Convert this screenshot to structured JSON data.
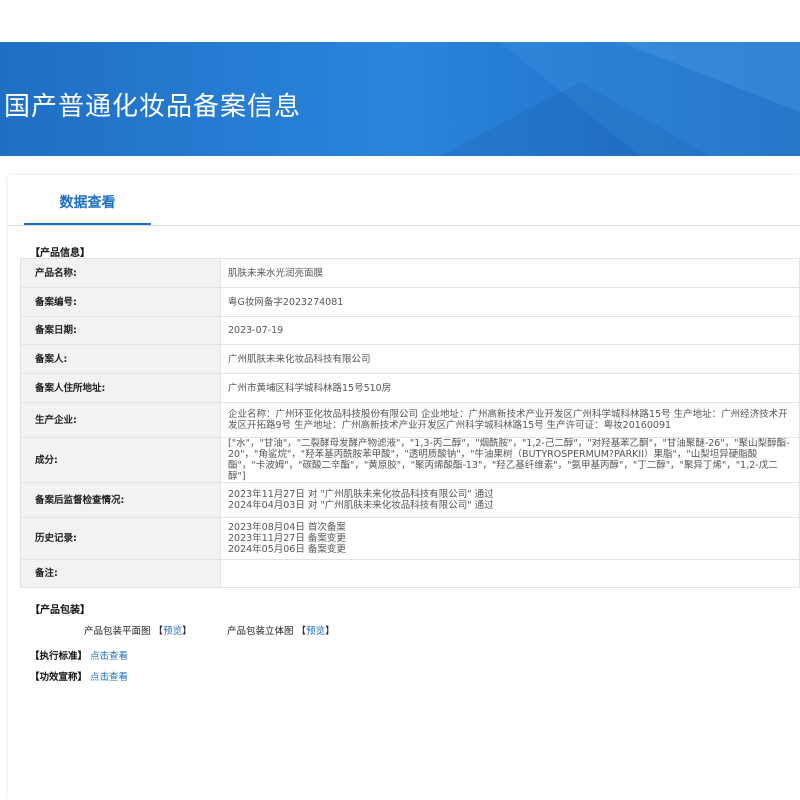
{
  "header": {
    "title": "国产普通化妆品备案信息"
  },
  "tabs": [
    {
      "label": "数据查看"
    }
  ],
  "product_info": {
    "section_title": "【产品信息】",
    "rows": [
      {
        "label": "产品名称:",
        "value": "肌肤未来水光润亮面膜"
      },
      {
        "label": "备案编号:",
        "value": "粤G妆网备字2023274081"
      },
      {
        "label": "备案日期:",
        "value": "2023-07-19"
      },
      {
        "label": "备案人:",
        "value": "广州肌肤未来化妆品科技有限公司"
      },
      {
        "label": "备案人住所地址:",
        "value": "广州市黄埔区科学城科林路15号510房"
      },
      {
        "label": "生产企业:",
        "value": "企业名称：广州环亚化妆品科技股份有限公司 企业地址：广州高新技术产业开发区广州科学城科林路15号 生产地址：广州经济技术开发区开拓路9号 生产地址：广州高新技术产业开发区广州科学城科林路15号 生产许可证：粤妆20160091"
      },
      {
        "label": "成分:",
        "value": "[\"水\"，\"甘油\"，\"二裂酵母发酵产物滤液\"，\"1,3-丙二醇\"，\"烟酰胺\"，\"1,2-己二醇\"，\"对羟基苯乙酮\"，\"甘油聚醚-26\"，\"聚山梨醇酯-20\"，\"角鲨烷\"，\"羟苯基丙酰胺苯甲酸\"，\"透明质酸钠\"，\"牛油果树（BUTYROSPERMUM?PARKII）果脂\"，\"山梨坦异硬脂酸酯\"，\"卡波姆\"，\"碳酸二辛酯\"，\"黄原胶\"，\"聚丙烯酸酯-13\"，\"羟乙基纤维素\"，\"氨甲基丙醇\"，\"丁二醇\"，\"聚异丁烯\"，\"1,2-戊二醇\"]"
      },
      {
        "label": "备案后监督检查情况:",
        "value": "2023年11月27日 对 \"广州肌肤未来化妆品科技有限公司\" 通过\n2024年04月03日 对 \"广州肌肤未来化妆品科技有限公司\" 通过"
      },
      {
        "label": "历史记录:",
        "value": "2023年08月04日 首次备案\n2023年11月27日 备案变更\n2024年05月06日 备案变更"
      },
      {
        "label": "备注:",
        "value": ""
      }
    ]
  },
  "packaging": {
    "section_title": "【产品包装】",
    "flat": {
      "label": "产品包装平面图",
      "bracket_open": "【",
      "link": "预览",
      "bracket_close": "】"
    },
    "solid": {
      "label": "产品包装立体图",
      "bracket_open": "【",
      "link": "预览",
      "bracket_close": "】"
    }
  },
  "standard": {
    "label": "【执行标准】",
    "link": "点击查看"
  },
  "efficacy": {
    "label": "【功效宣称】",
    "link": "点击查看"
  }
}
